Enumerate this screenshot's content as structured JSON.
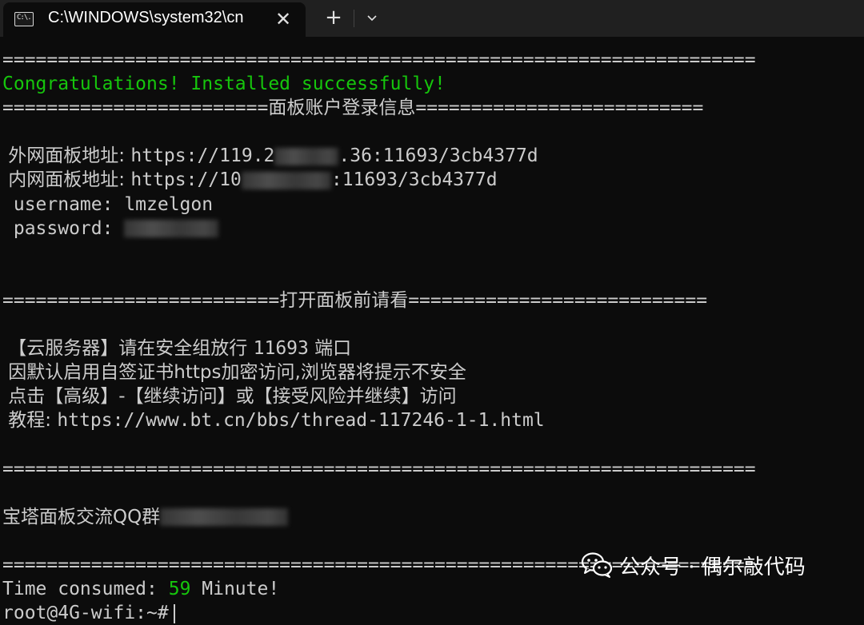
{
  "window": {
    "tab_title": "C:\\WINDOWS\\system32\\cn",
    "tab_icon_text": "C:\\.",
    "close_symbol": "✕",
    "new_tab_symbol": "+",
    "dropdown_icon": "chevron-down-icon"
  },
  "terminal": {
    "sep_full": "====================================================================",
    "congrats": "Congratulations! Installed successfully!",
    "sep_login_left": "========================",
    "login_title": "面板账户登录信息",
    "sep_login_right": "==========================",
    "ext_label": " 外网面板地址: ",
    "ext_url_start": "https://119.2",
    "ext_url_end": ".36:11693/3cb4377d",
    "int_label": " 内网面板地址: ",
    "int_url_start": "https://10",
    "int_url_end": ":11693/3cb4377d",
    "username_line": " username: lmzelgon",
    "password_label": " password: ",
    "sep_open_left": "=========================",
    "open_title": "打开面板前请看",
    "sep_open_right": "===========================",
    "notice1_a": " 【云服务器】请在安全组放行 ",
    "notice1_port": "11693",
    "notice1_b": " 端口",
    "notice2": " 因默认启用自签证书https加密访问,浏览器将提示不安全",
    "notice3": " 点击【高级】-【继续访问】或【接受风险并继续】访问",
    "tutorial_label": " 教程: ",
    "tutorial_url": "https://www.bt.cn/bbs/thread-117246-1-1.html",
    "qq_label": "宝塔面板交流QQ群",
    "time_prefix": "Time consumed: ",
    "time_value": "59",
    "time_suffix": " Minute!",
    "prompt": "root@4G-wifi:~#"
  },
  "watermark": {
    "icon": "wechat-icon",
    "text": "公众号 · 偶尔敲代码"
  },
  "colors": {
    "success": "#16c60c",
    "text": "#cccccc",
    "background": "#0c0c0c"
  }
}
